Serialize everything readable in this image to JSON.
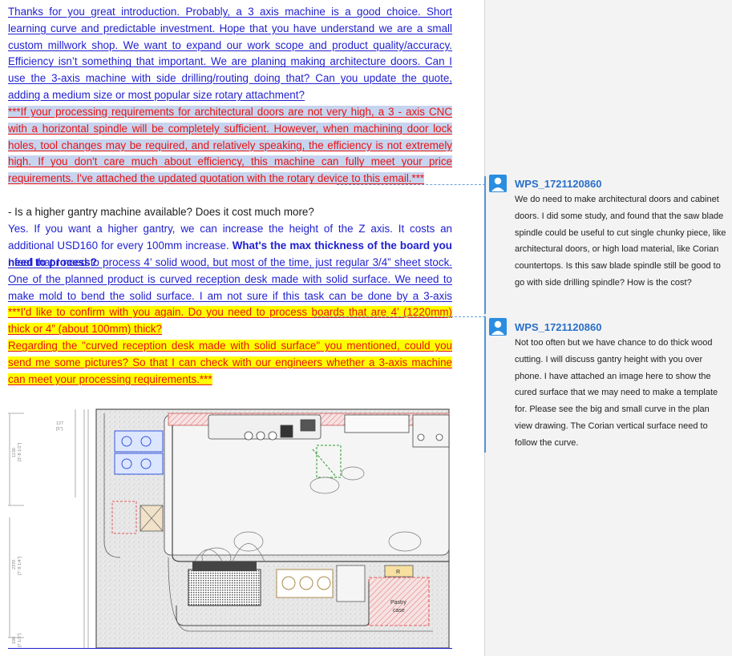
{
  "document": {
    "p1": "Thanks for you great introduction. Probably, a 3 axis machine is a good choice. Short learning curve and predictable investment. Hope that you have understand we are a small custom millwork shop. We want to expand our work scope and product quality/accuracy. Efficiency isn’t something that important. We are planing making architecture doors. Can I use the 3-axis machine with side drilling/routing doing that? Can you update the quote, adding a medium size or most popular size rotary attachment?",
    "p2": "***If your processing requirements for architectural doors are not very high, a 3 - axis CNC with a horizontal spindle will be completely sufficient. However, when machining door lock holes, tool changes may be required, and relatively speaking, the efficiency is not extremely high. If you don't care much about efficiency, this machine can fully meet your price requirements. I've attached the updated quotation with the rotary device to this email.***",
    "p3": "- Is a higher gantry machine available? Does it cost much more?",
    "p4a": "Yes. If you want a higher gantry, we can increase the height of the Z axis. It costs an additional USD160 for every 100mm increase. ",
    "p4b": "What's the max thickness of the board you need to process?",
    "p5": "I feel that I need to process 4’ solid wood, but most of the time, just regular 3/4” sheet stock. One of the planned product is curved reception desk made with solid surface. We need to make mold to bend the solid surface. I am not sure if this task can be done by a 3-axis machine.",
    "p6": "***I'd like to confirm with you again. Do you need to process boards that are 4’ (1220mm) thick or 4” (about 100mm) thick? ",
    "p7": "Regarding the \"curved reception desk made with solid surface\" you mentioned, could you send me some pictures? So that I can check with our engineers whether a 3-axis machine can meet your processing requirements.***"
  },
  "drawing": {
    "dim1": "127",
    "dim1b": "[5\"]",
    "dim2": "1130",
    "dim2b": "[3'-8 1/2\"]",
    "dim3": "2370",
    "dim3b": "[7'-9 1/4\"]",
    "dim4": "190",
    "dim4b": "[7 1/2\"]",
    "label_r": "R",
    "label_pastry": "Pastry",
    "label_case": "case"
  },
  "comments": [
    {
      "author": "WPS_1721120860",
      "text": "We do need to make architectural doors and cabinet doors. I did some study, and found that the saw blade spindle could be useful to cut single chunky piece, like architectural doors, or high load material, like Corian countertops. Is this saw blade spindle still be good to go with side drilling spindle? How is the cost?"
    },
    {
      "author": "WPS_1721120860",
      "text": "Not too often but we have chance to do thick wood cutting. I will discuss gantry height with you over phone. I have attached an image here to show the cured surface that we may need to make a template for. Please see the big and small curve in the plan view drawing. The Corian vertical surface need to follow the curve."
    }
  ],
  "colors": {
    "text_blue": "#1f1fd1",
    "text_red": "#e81313",
    "highlight_blue": "#c7d4ef",
    "highlight_yellow": "#ffff00",
    "comment_accent": "#2a6fc9",
    "avatar": "#2a8ee0"
  },
  "icons": [
    "user-avatar-icon"
  ]
}
